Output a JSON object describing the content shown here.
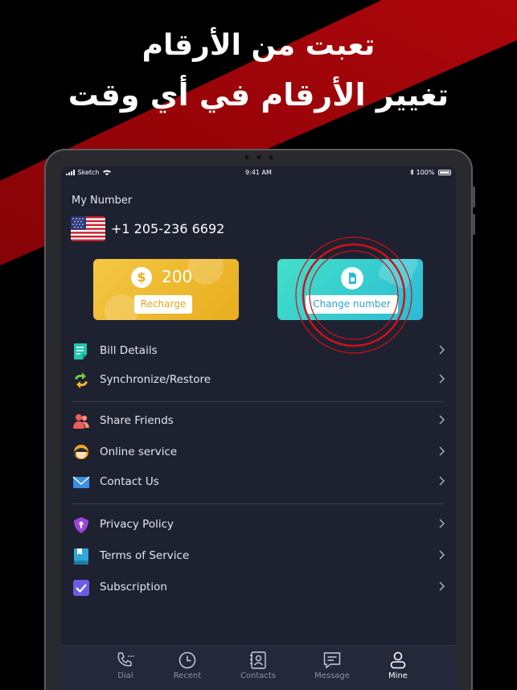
{
  "promo": {
    "line1": "تعبت من الأرقام",
    "line2": "تغيير الأرقام في أي وقت"
  },
  "status_bar": {
    "carrier": "Sketch",
    "time": "9:41 AM",
    "battery": "100%"
  },
  "account": {
    "my_number_label": "My Number",
    "phone_number": "+1 205-236 6692",
    "flag_icon": "us-flag-icon"
  },
  "cards": {
    "balance": "200",
    "recharge_label": "Recharge",
    "change_number_label": "Change number"
  },
  "menu": {
    "group1": [
      {
        "label": "Bill Details",
        "icon": "bill-icon"
      },
      {
        "label": "Synchronize/Restore",
        "icon": "sync-icon"
      }
    ],
    "group2": [
      {
        "label": "Share Friends",
        "icon": "friends-icon"
      },
      {
        "label": "Online service",
        "icon": "support-icon"
      },
      {
        "label": "Contact Us",
        "icon": "mail-icon"
      }
    ],
    "group3": [
      {
        "label": "Privacy Policy",
        "icon": "shield-icon"
      },
      {
        "label": "Terms of Service",
        "icon": "book-icon"
      },
      {
        "label": "Subscription",
        "icon": "checkbox-icon"
      }
    ]
  },
  "tabs": [
    {
      "label": "Dial",
      "icon": "dial-icon"
    },
    {
      "label": "Recent",
      "icon": "clock-icon"
    },
    {
      "label": "Contacts",
      "icon": "contacts-icon"
    },
    {
      "label": "Message",
      "icon": "message-icon"
    },
    {
      "label": "Mine",
      "icon": "person-icon",
      "active": true
    }
  ],
  "colors": {
    "banner_red": "#a3060b",
    "screen_bg": "#1e2130",
    "gold": "#e9ad1e",
    "teal": "#2cbbd6",
    "ring_red": "#d0101a"
  }
}
